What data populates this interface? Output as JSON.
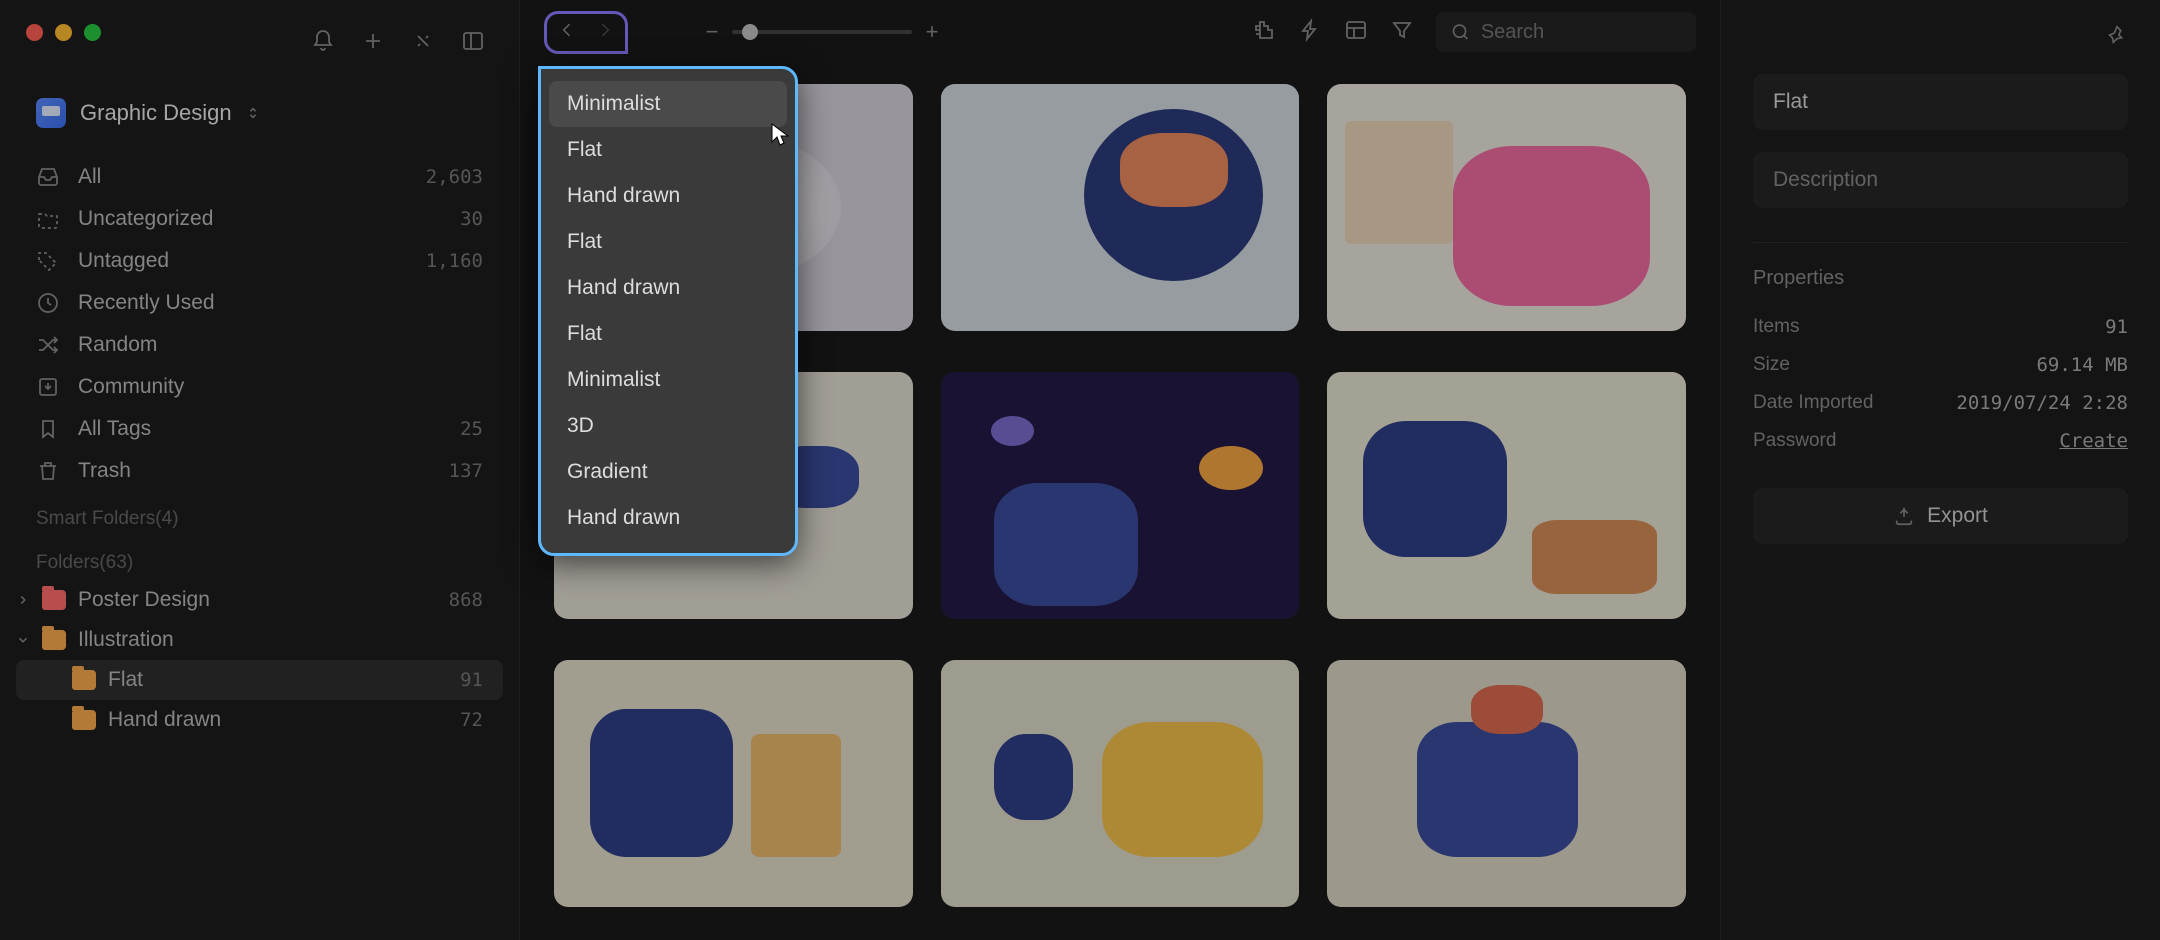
{
  "library": {
    "name": "Graphic Design"
  },
  "sidebar": {
    "items": [
      {
        "label": "All",
        "count": "2,603"
      },
      {
        "label": "Uncategorized",
        "count": "30"
      },
      {
        "label": "Untagged",
        "count": "1,160"
      },
      {
        "label": "Recently Used",
        "count": ""
      },
      {
        "label": "Random",
        "count": ""
      },
      {
        "label": "Community",
        "count": ""
      },
      {
        "label": "All Tags",
        "count": "25"
      },
      {
        "label": "Trash",
        "count": "137"
      }
    ],
    "smart_folders_label": "Smart Folders(4)",
    "folders_label": "Folders(63)",
    "folders": [
      {
        "label": "Poster Design",
        "count": "868"
      },
      {
        "label": "Illustration",
        "count": ""
      }
    ],
    "subfolders": [
      {
        "label": "Flat",
        "count": "91"
      },
      {
        "label": "Hand drawn",
        "count": "72"
      }
    ]
  },
  "search": {
    "placeholder": "Search"
  },
  "dropdown": {
    "items": [
      "Minimalist",
      "Flat",
      "Hand drawn",
      "Flat",
      "Hand drawn",
      "Flat",
      "Minimalist",
      "3D",
      "Gradient",
      "Hand drawn"
    ]
  },
  "inspector": {
    "title": "Flat",
    "description_placeholder": "Description",
    "properties_label": "Properties",
    "props": {
      "items_label": "Items",
      "items_value": "91",
      "size_label": "Size",
      "size_value": "69.14 MB",
      "date_label": "Date Imported",
      "date_value": "2019/07/24 2:28",
      "password_label": "Password",
      "password_value": "Create"
    },
    "export_label": "Export"
  }
}
